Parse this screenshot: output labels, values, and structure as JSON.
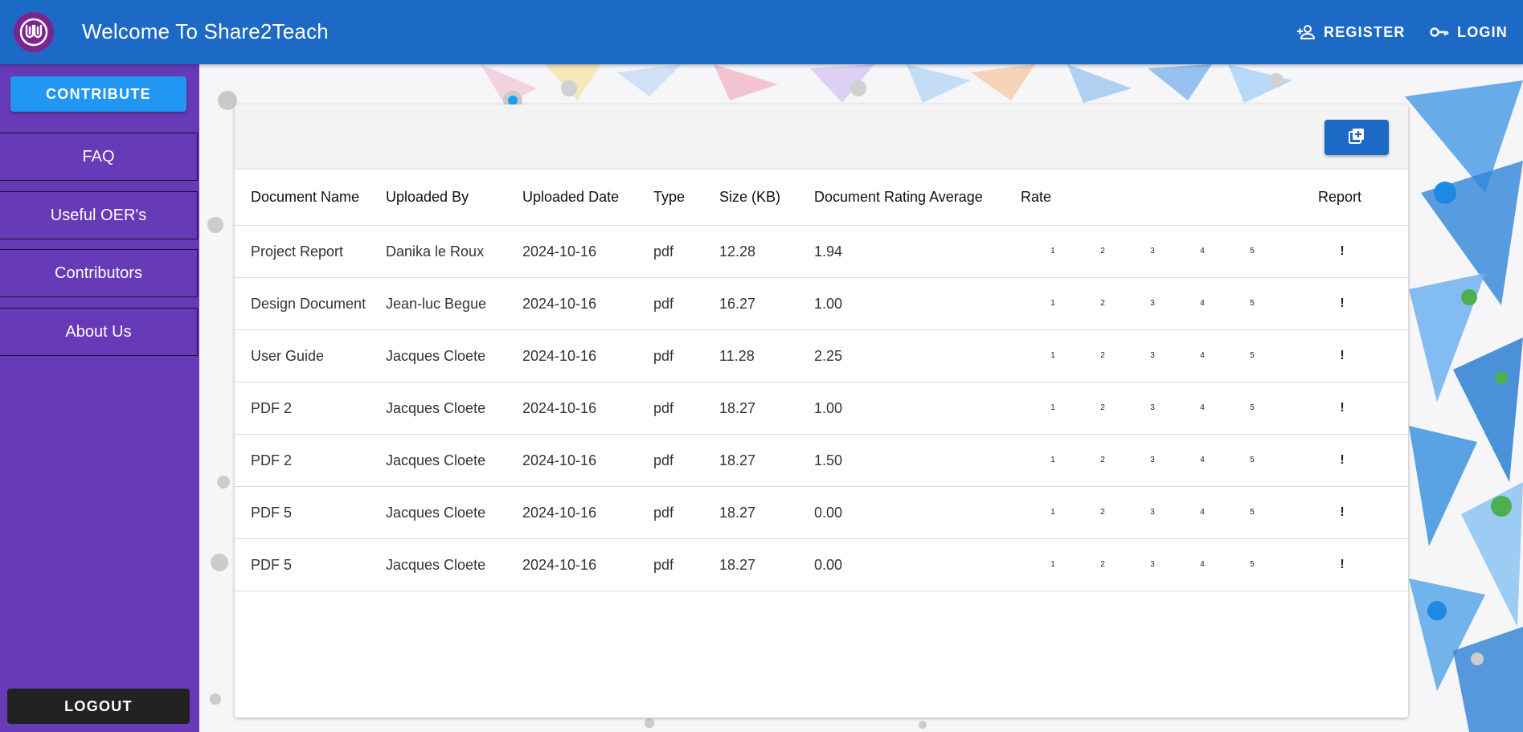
{
  "header": {
    "title": "Welcome To Share2Teach",
    "register_label": "REGISTER",
    "login_label": "LOGIN"
  },
  "sidebar": {
    "contribute_label": "CONTRIBUTE",
    "items": [
      {
        "label": "FAQ"
      },
      {
        "label": "Useful OER's"
      },
      {
        "label": "Contributors"
      },
      {
        "label": "About Us"
      }
    ],
    "logout_label": "LOGOUT"
  },
  "table": {
    "columns": [
      "Document Name",
      "Uploaded By",
      "Uploaded Date",
      "Type",
      "Size (KB)",
      "Document Rating Average",
      "Rate",
      "Report"
    ],
    "rate_options": [
      "1",
      "2",
      "3",
      "4",
      "5"
    ],
    "report_symbol": "!",
    "rows": [
      {
        "name": "Project Report",
        "by": "Danika le Roux",
        "date": "2024-10-16",
        "type": "pdf",
        "size": "12.28",
        "rating": "1.94"
      },
      {
        "name": "Design Document",
        "by": "Jean-luc Begue",
        "date": "2024-10-16",
        "type": "pdf",
        "size": "16.27",
        "rating": "1.00"
      },
      {
        "name": "User Guide",
        "by": "Jacques Cloete",
        "date": "2024-10-16",
        "type": "pdf",
        "size": "11.28",
        "rating": "2.25"
      },
      {
        "name": "PDF 2",
        "by": "Jacques Cloete",
        "date": "2024-10-16",
        "type": "pdf",
        "size": "18.27",
        "rating": "1.00"
      },
      {
        "name": "PDF 2",
        "by": "Jacques Cloete",
        "date": "2024-10-16",
        "type": "pdf",
        "size": "18.27",
        "rating": "1.50"
      },
      {
        "name": "PDF 5",
        "by": "Jacques Cloete",
        "date": "2024-10-16",
        "type": "pdf",
        "size": "18.27",
        "rating": "0.00"
      },
      {
        "name": "PDF 5",
        "by": "Jacques Cloete",
        "date": "2024-10-16",
        "type": "pdf",
        "size": "18.27",
        "rating": "0.00"
      }
    ]
  },
  "icons": {
    "logo": "university-logo-icon",
    "register": "person-add-icon",
    "login": "key-icon",
    "add": "library-add-icon"
  },
  "colors": {
    "header": "#1d6ac6",
    "sidebar": "#673ab7",
    "contribute": "#2196f3",
    "logout": "#222222"
  }
}
